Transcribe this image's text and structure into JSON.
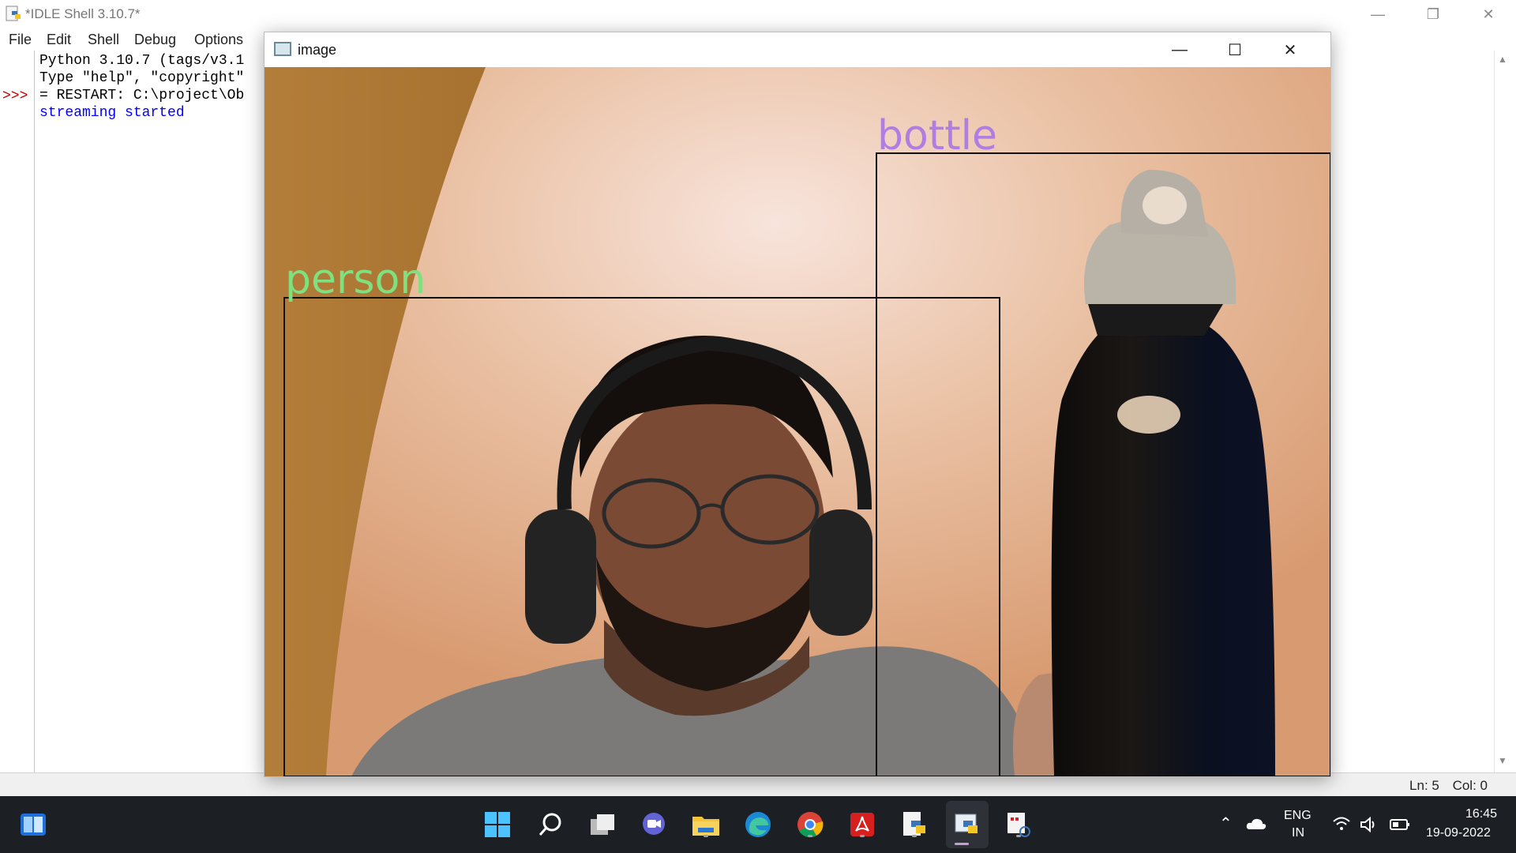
{
  "idle": {
    "title": "*IDLE Shell 3.10.7*",
    "menu": [
      "File",
      "Edit",
      "Shell",
      "Debug",
      "Options"
    ],
    "prompt": ">>>",
    "lines": [
      "Python 3.10.7 (tags/v3.1",
      "Type \"help\", \"copyright\"",
      "",
      "= RESTART: C:\\project\\Ob",
      "streaming started"
    ],
    "status": {
      "line": "Ln: 5",
      "col": "Col: 0"
    }
  },
  "image_window": {
    "title": "image",
    "detections": [
      {
        "label": "person",
        "color": "#7fe07f"
      },
      {
        "label": "bottle",
        "color": "#b07ee0"
      }
    ]
  },
  "taskbar": {
    "apps": [
      "start-icon",
      "search-icon",
      "task-view-icon",
      "chat-icon",
      "file-explorer-icon",
      "edge-icon",
      "chrome-icon",
      "acrobat-icon",
      "python-file-icon",
      "idle-icon",
      "snipping-tool-icon"
    ],
    "tray": {
      "lang": "ENG",
      "region": "IN",
      "time": "16:45",
      "date": "19-09-2022"
    }
  }
}
